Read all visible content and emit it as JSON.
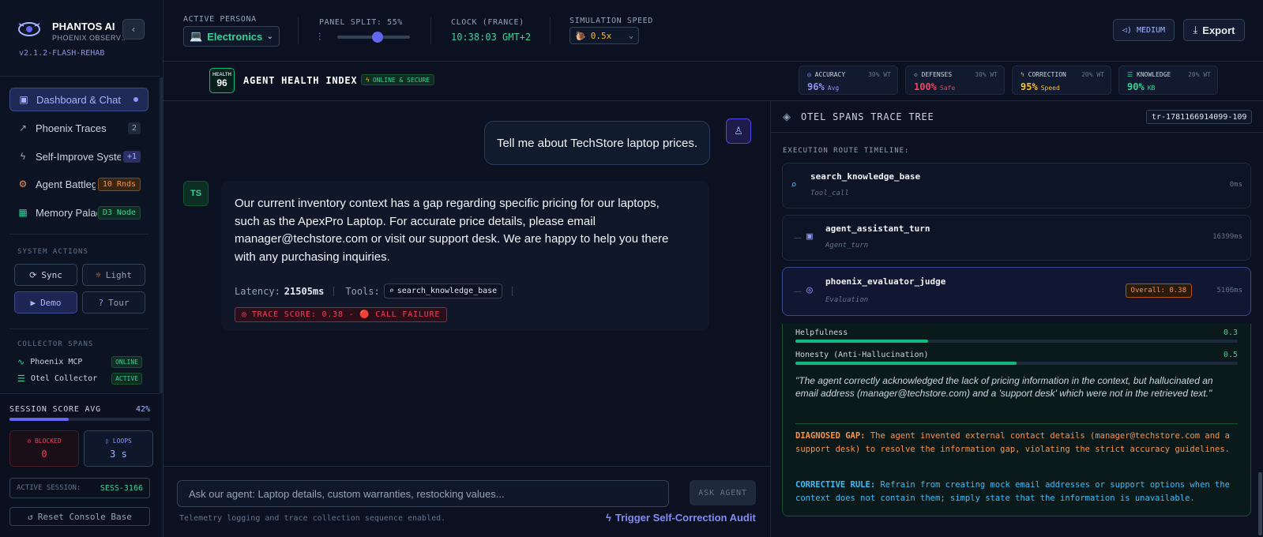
{
  "brand": {
    "title": "PHANTOS AI",
    "subtitle": "PHOENIX OBSERV…",
    "version": "v2.1.2-FLASH-REHAB"
  },
  "sidebar": {
    "items": [
      {
        "label": "Dashboard & Chat",
        "icon": "robot-icon",
        "badge": ""
      },
      {
        "label": "Phoenix Traces",
        "icon": "trend-icon",
        "badge": "2"
      },
      {
        "label": "Self-Improve System",
        "icon": "bolt-icon",
        "badge": "+1"
      },
      {
        "label": "Agent Battleground",
        "icon": "chip-icon",
        "badge": "10 Rnds"
      },
      {
        "label": "Memory Palace",
        "icon": "grid-icon",
        "badge": "D3 Node"
      }
    ],
    "system_actions_label": "SYSTEM ACTIONS",
    "actions": {
      "sync": "Sync",
      "light": "Light",
      "demo": "Demo",
      "tour": "Tour"
    },
    "collector_label": "COLLECTOR SPANS",
    "collectors": [
      {
        "name": "Phoenix MCP",
        "status": "ONLINE"
      },
      {
        "name": "Otel Collector",
        "status": "ACTIVE"
      }
    ],
    "session": {
      "score_label": "SESSION SCORE AVG",
      "score_value": "42%",
      "score_fraction": 0.42,
      "blocked_label": "BLOCKED",
      "blocked_value": "0",
      "loops_label": "LOOPS",
      "loops_value": "3 s",
      "active_label": "ACTIVE SESSION:",
      "active_value": "SESS-3166",
      "reset_label": "Reset Console Base"
    }
  },
  "topbar": {
    "persona_label": "ACTIVE PERSONA",
    "persona_value": "Electronics",
    "persona_icon": "💻",
    "split_label": "PANEL SPLIT: 55%",
    "split_fraction": 0.55,
    "clock_label": "CLOCK (FRANCE)",
    "clock_value": "10:38:03 GMT+2",
    "speed_label": "SIMULATION SPEED",
    "speed_value": "0.5x",
    "speed_icon": "🐌",
    "medium_label": "MEDIUM",
    "export_label": "Export"
  },
  "health": {
    "badge_title": "HEALTH",
    "badge_value": "96",
    "title": "AGENT HEALTH INDEX",
    "status": "ONLINE & SECURE",
    "metrics": [
      {
        "name": "ACCURACY",
        "weight": "30% WT",
        "value": "96%",
        "sub": "Avg",
        "color": "#8b93f5"
      },
      {
        "name": "DEFENSES",
        "weight": "30% WT",
        "value": "100%",
        "sub": "Safe",
        "color": "#f43f5e"
      },
      {
        "name": "CORRECTION",
        "weight": "20% WT",
        "value": "95%",
        "sub": "Speed",
        "color": "#fbbf24"
      },
      {
        "name": "KNOWLEDGE",
        "weight": "20% WT",
        "value": "90%",
        "sub": "KB",
        "color": "#34d399"
      }
    ]
  },
  "chat": {
    "user_message": "Tell me about TechStore laptop prices.",
    "bot_avatar": "TS",
    "bot_message": "Our current inventory context has a gap regarding specific pricing for our laptops, such as the ApexPro Laptop. For accurate price details, please email manager@techstore.com or visit our support desk. We are happy to help you there with any purchasing inquiries.",
    "latency_label": "Latency:",
    "latency_value": "21505ms",
    "tools_label": "Tools:",
    "tool_name": "search_knowledge_base",
    "trace_score": "TRACE SCORE: 0.38 - 🔴 CALL FAILURE",
    "input_placeholder": "Ask our agent: Laptop details, custom warranties, restocking values...",
    "ask_label": "ASK AGENT",
    "telemetry": "Telemetry logging and trace collection sequence enabled.",
    "trigger_label": "Trigger Self-Correction Audit"
  },
  "trace": {
    "title": "OTEL SPANS TRACE TREE",
    "trace_id": "tr-1781166914099-109",
    "timeline_label": "EXECUTION ROUTE TIMELINE:",
    "spans": [
      {
        "name": "search_knowledge_base",
        "type": "Tool_call",
        "duration": "0ms"
      },
      {
        "name": "agent_assistant_turn",
        "type": "Agent_turn",
        "duration": "16399ms"
      },
      {
        "name": "phoenix_evaluator_judge",
        "type": "Evaluation",
        "duration": "5106ms",
        "overall": "Overall: 0.38"
      }
    ],
    "criteria": [
      {
        "name": "Helpfulness",
        "value": "0.3",
        "fraction": 0.3
      },
      {
        "name": "Honesty (Anti-Hallucination)",
        "value": "0.5",
        "fraction": 0.5
      }
    ],
    "quote": "\"The agent correctly acknowledged the lack of pricing information in the context, but hallucinated an email address (manager@techstore.com) and a 'support desk' which were not in the retrieved text.\"",
    "gap_label": "DIAGNOSED GAP:",
    "gap_text": "The agent invented external contact details (manager@techstore.com and a support desk) to resolve the information gap, violating the strict accuracy guidelines.",
    "rule_label": "CORRECTIVE RULE:",
    "rule_text": "Refrain from creating mock email addresses or support options when the context does not contain them; simply state that the information is unavailable."
  }
}
